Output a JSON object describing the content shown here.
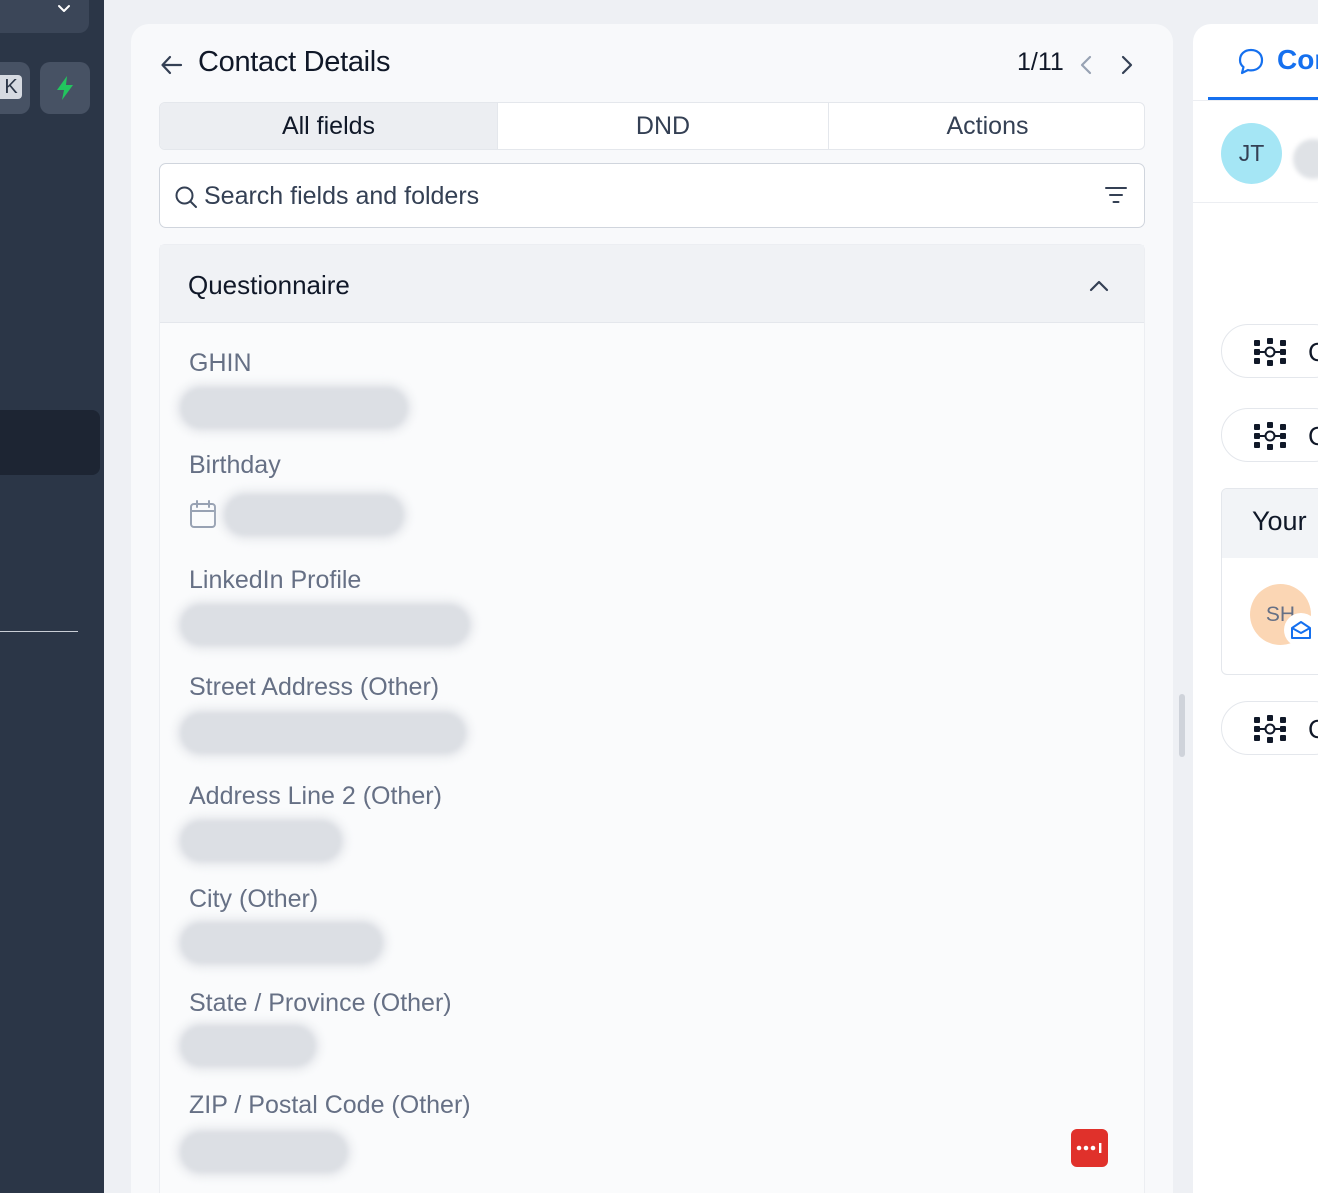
{
  "header": {
    "title": "Contact Details",
    "pager": "1/11"
  },
  "tabs": [
    {
      "label": "All fields",
      "active": true
    },
    {
      "label": "DND",
      "active": false
    },
    {
      "label": "Actions",
      "active": false
    }
  ],
  "search": {
    "placeholder": "Search fields and folders"
  },
  "section": {
    "title": "Questionnaire",
    "fields": [
      {
        "label": "GHIN"
      },
      {
        "label": "Birthday"
      },
      {
        "label": "LinkedIn Profile"
      },
      {
        "label": "Street Address (Other)"
      },
      {
        "label": "Address Line 2 (Other)"
      },
      {
        "label": "City (Other)"
      },
      {
        "label": "State / Province (Other)"
      },
      {
        "label": "ZIP / Postal Code (Other)"
      }
    ]
  },
  "sidebar": {
    "shortcut_key": "K"
  },
  "right_panel": {
    "tab_label": "Cor",
    "contact_initials": "JT",
    "chip_letter": "C",
    "box_title": "Your",
    "user_initials": "SH"
  },
  "colors": {
    "accent": "#1570ef",
    "sidebar_bg": "#2b3647",
    "bolt": "#22c55e",
    "more_button": "#e0312b",
    "avatar_jt": "#a5e6f5",
    "avatar_sh": "#fbd6b4"
  },
  "icons": [
    "chevron-down-icon",
    "lightning-icon",
    "back-arrow-icon",
    "chevron-left-icon",
    "chevron-right-icon",
    "search-icon",
    "filter-icon",
    "chevron-up-icon",
    "calendar-icon",
    "more-icon",
    "chat-icon",
    "workflow-icon",
    "mail-icon"
  ]
}
